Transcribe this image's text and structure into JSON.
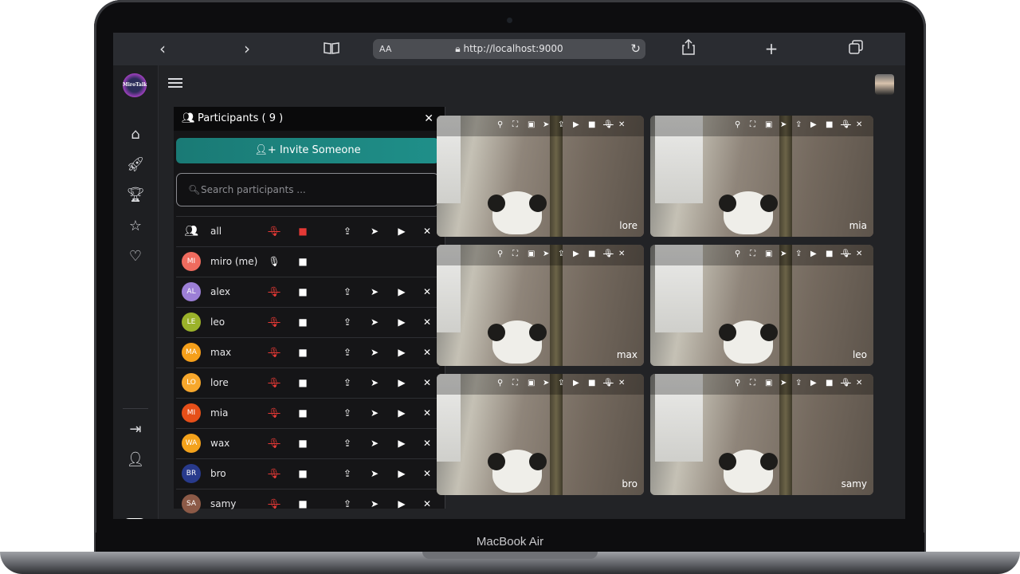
{
  "device": {
    "label": "MacBook Air"
  },
  "browser": {
    "text_size_label": "AA",
    "url": "http://localhost:9000",
    "icons": [
      "back-icon",
      "forward-icon",
      "reader-icon",
      "share-icon",
      "new-tab-icon",
      "tabs-icon",
      "lock-icon",
      "reload-icon"
    ]
  },
  "app": {
    "logo_text": "MiroTalk",
    "sidebar_icons": [
      "home-icon",
      "rocket-icon",
      "trophy-icon",
      "star-icon",
      "heart-icon",
      "exit-icon",
      "add-user-icon",
      "theme-toggle"
    ]
  },
  "participants_panel": {
    "title": "Participants ( 9 )",
    "close_label": "✕",
    "invite_label": "Invite Someone",
    "search_placeholder": "Search participants ...",
    "rows": [
      {
        "name": "all",
        "initials": "",
        "color": "",
        "mic_muted": true,
        "video_off": true
      },
      {
        "name": "miro (me)",
        "initials": "MI",
        "color": "#ef6b5e",
        "mic_muted": false,
        "video_off": false
      },
      {
        "name": "alex",
        "initials": "AL",
        "color": "#9c7fd6",
        "mic_muted": true,
        "video_off": false
      },
      {
        "name": "leo",
        "initials": "LE",
        "color": "#9bb22a",
        "mic_muted": true,
        "video_off": false
      },
      {
        "name": "max",
        "initials": "MA",
        "color": "#f59f1a",
        "mic_muted": true,
        "video_off": false
      },
      {
        "name": "lore",
        "initials": "LO",
        "color": "#f7a72c",
        "mic_muted": true,
        "video_off": false
      },
      {
        "name": "mia",
        "initials": "MI",
        "color": "#e64f19",
        "mic_muted": true,
        "video_off": false
      },
      {
        "name": "wax",
        "initials": "WA",
        "color": "#f4a21b",
        "mic_muted": true,
        "video_off": false
      },
      {
        "name": "bro",
        "initials": "BR",
        "color": "#283a8c",
        "mic_muted": true,
        "video_off": false
      },
      {
        "name": "samy",
        "initials": "SA",
        "color": "#8c5a47",
        "mic_muted": true,
        "video_off": false
      }
    ]
  },
  "video_tiles": [
    {
      "name": "lore"
    },
    {
      "name": "mia"
    },
    {
      "name": "max"
    },
    {
      "name": "leo"
    },
    {
      "name": "bro"
    },
    {
      "name": "samy"
    }
  ],
  "colors": {
    "accent": "#1f8f89",
    "muted_red": "#e53935"
  }
}
